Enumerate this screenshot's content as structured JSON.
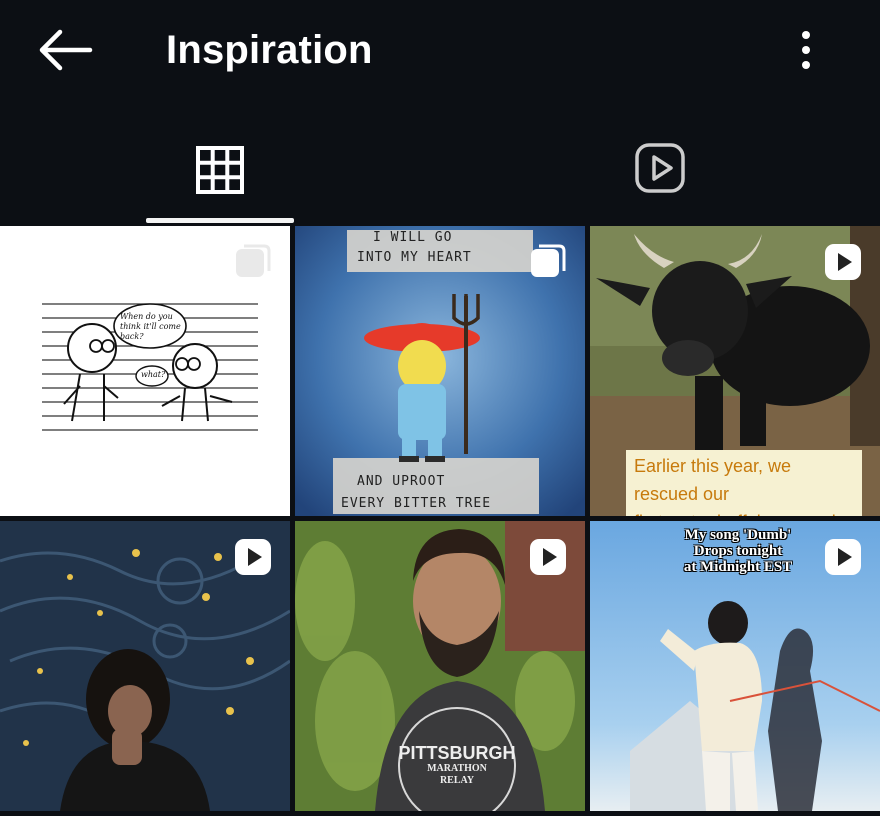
{
  "header": {
    "title": "Inspiration",
    "back_icon": "arrow-left-icon",
    "more_icon": "more-vertical-icon"
  },
  "tabs": [
    {
      "name": "posts-grid",
      "icon": "grid-icon",
      "selected": true
    },
    {
      "name": "reels",
      "icon": "reels-play-icon",
      "selected": false
    }
  ],
  "posts": [
    {
      "type": "carousel",
      "desc": "comic sketch",
      "bubble1": "When do you think it'll come back?",
      "bubble2": "what?"
    },
    {
      "type": "carousel",
      "desc": "painted comic",
      "top_text_1": "I WILL GO",
      "top_text_2": "INTO MY HEART",
      "bottom_text_1": "AND UPROOT",
      "bottom_text_2": "EVERY BITTER TREE"
    },
    {
      "type": "reel",
      "desc": "water buffalo",
      "caption_line1": "Earlier this year, we rescued our",
      "caption_line2": "first water buffalo, named Rufus"
    },
    {
      "type": "reel",
      "desc": "starry night portrait"
    },
    {
      "type": "reel",
      "desc": "bearded man",
      "shirt_line1": "PITTSBURGH",
      "shirt_line2": "MARATHON",
      "shirt_line3": "RELAY"
    },
    {
      "type": "reel",
      "desc": "song promo",
      "caption_line1": "My song 'Dumb'",
      "caption_line2": "Drops tonight",
      "caption_line3": "at Midnight EST"
    }
  ],
  "colors": {
    "background": "#0c0f14",
    "text": "#ffffff",
    "indicator": "#f4f4f4"
  }
}
